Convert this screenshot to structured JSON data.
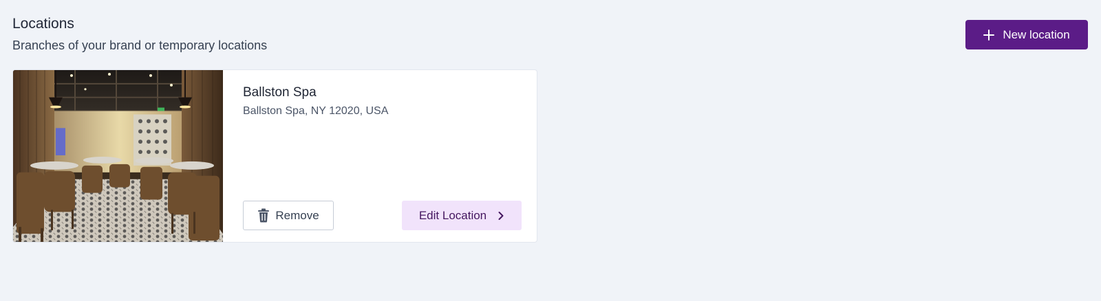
{
  "header": {
    "title": "Locations",
    "subtitle": "Branches of your brand or temporary locations"
  },
  "toolbar": {
    "new_location_label": "New location",
    "new_location_icon": "plus-icon"
  },
  "locations": [
    {
      "name": "Ballston Spa",
      "address": "Ballston Spa, NY 12020, USA",
      "image": "restaurant-interior-photo",
      "remove_label": "Remove",
      "remove_icon": "trash-icon",
      "edit_label": "Edit Location",
      "edit_icon": "chevron-right-icon"
    }
  ],
  "colors": {
    "page_background": "#f0f3f8",
    "brand_primary": "#5b1c87",
    "edit_button_bg": "#f1e3fb",
    "edit_button_text": "#44165f"
  }
}
